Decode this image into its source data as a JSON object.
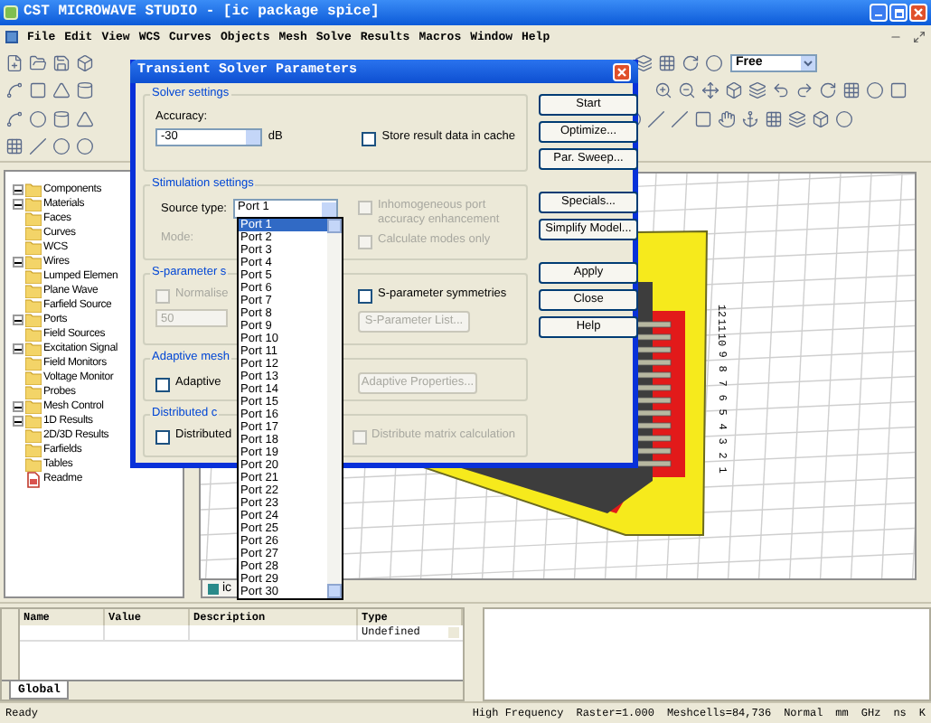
{
  "window": {
    "title": "CST MICROWAVE STUDIO - [ic package spice]"
  },
  "menu": [
    "File",
    "Edit",
    "View",
    "WCS",
    "Curves",
    "Objects",
    "Mesh",
    "Solve",
    "Results",
    "Macros",
    "Window",
    "Help"
  ],
  "toolbar": {
    "mode_select": "Free"
  },
  "tree": [
    {
      "label": "Components",
      "kind": "group"
    },
    {
      "label": "Materials",
      "kind": "group"
    },
    {
      "label": "Faces",
      "kind": "folder"
    },
    {
      "label": "Curves",
      "kind": "folder"
    },
    {
      "label": "WCS",
      "kind": "folder"
    },
    {
      "label": "Wires",
      "kind": "group"
    },
    {
      "label": "Lumped Elemen",
      "kind": "folder"
    },
    {
      "label": "Plane Wave",
      "kind": "folder"
    },
    {
      "label": "Farfield Source",
      "kind": "folder"
    },
    {
      "label": "Ports",
      "kind": "group"
    },
    {
      "label": "Field Sources",
      "kind": "folder"
    },
    {
      "label": "Excitation Signal",
      "kind": "group"
    },
    {
      "label": "Field Monitors",
      "kind": "folder"
    },
    {
      "label": "Voltage Monitor",
      "kind": "folder"
    },
    {
      "label": "Probes",
      "kind": "folder"
    },
    {
      "label": "Mesh Control",
      "kind": "group"
    },
    {
      "label": "1D Results",
      "kind": "group"
    },
    {
      "label": "2D/3D Results",
      "kind": "folder"
    },
    {
      "label": "Farfields",
      "kind": "folder"
    },
    {
      "label": "Tables",
      "kind": "folder"
    },
    {
      "label": "Readme",
      "kind": "document"
    }
  ],
  "canvas": {
    "port_numbers": [
      "12",
      "11",
      "10",
      "9",
      "8",
      "7",
      "6",
      "5",
      "4",
      "3",
      "2",
      "1"
    ],
    "doc_tab": "ic"
  },
  "dialog": {
    "title": "Transient Solver Parameters",
    "solver_settings": {
      "heading": "Solver settings",
      "accuracy_label": "Accuracy:",
      "accuracy": "-30",
      "unit": "dB",
      "store_cache": {
        "label": "Store result data in cache",
        "checked": false,
        "disabled": false
      }
    },
    "stimulation": {
      "heading": "Stimulation settings",
      "source_label": "Source type:",
      "source": "Port 1",
      "inhomogeneous": {
        "label": "Inhomogeneous port accuracy enhancement",
        "checked": false,
        "disabled": true
      },
      "mode_label": "Mode:",
      "calc_modes": {
        "label": "Calculate modes only",
        "checked": false,
        "disabled": true
      }
    },
    "sparams": {
      "heading": "S-parameter s",
      "normalize": {
        "label": "Normalise",
        "checked": false,
        "disabled": true
      },
      "impedance": "50",
      "symmetries": {
        "label": "S-parameter symmetries",
        "checked": false,
        "disabled": false
      },
      "list_button": {
        "label": "S-Parameter List...",
        "disabled": true
      }
    },
    "adaptive": {
      "heading": "Adaptive mesh",
      "checkbox": {
        "label": "Adaptive",
        "checked": false,
        "disabled": false
      },
      "button": {
        "label": "Adaptive Properties...",
        "disabled": true
      }
    },
    "distributed": {
      "heading": "Distributed c",
      "checkbox": {
        "label": "Distributed",
        "checked": false,
        "disabled": false
      },
      "matrix": {
        "label": "Distribute matrix calculation",
        "checked": false,
        "disabled": true
      }
    },
    "button_groups": [
      [
        "Start",
        "Optimize...",
        "Par. Sweep..."
      ],
      [
        "Specials...",
        "Simplify Model..."
      ],
      [
        "Apply",
        "Close",
        "Help"
      ]
    ],
    "source_list": [
      {
        "label": "Port 1",
        "selected": true
      },
      {
        "label": "Port 2",
        "selected": false
      },
      {
        "label": "Port 3",
        "selected": false
      },
      {
        "label": "Port 4",
        "selected": false
      },
      {
        "label": "Port 5",
        "selected": false
      },
      {
        "label": "Port 6",
        "selected": false
      },
      {
        "label": "Port 7",
        "selected": false
      },
      {
        "label": "Port 8",
        "selected": false
      },
      {
        "label": "Port 9",
        "selected": false
      },
      {
        "label": "Port 10",
        "selected": false
      },
      {
        "label": "Port 11",
        "selected": false
      },
      {
        "label": "Port 12",
        "selected": false
      },
      {
        "label": "Port 13",
        "selected": false
      },
      {
        "label": "Port 14",
        "selected": false
      },
      {
        "label": "Port 15",
        "selected": false
      },
      {
        "label": "Port 16",
        "selected": false
      },
      {
        "label": "Port 17",
        "selected": false
      },
      {
        "label": "Port 18",
        "selected": false
      },
      {
        "label": "Port 19",
        "selected": false
      },
      {
        "label": "Port 20",
        "selected": false
      },
      {
        "label": "Port 21",
        "selected": false
      },
      {
        "label": "Port 22",
        "selected": false
      },
      {
        "label": "Port 23",
        "selected": false
      },
      {
        "label": "Port 24",
        "selected": false
      },
      {
        "label": "Port 25",
        "selected": false
      },
      {
        "label": "Port 26",
        "selected": false
      },
      {
        "label": "Port 27",
        "selected": false
      },
      {
        "label": "Port 28",
        "selected": false
      },
      {
        "label": "Port 29",
        "selected": false
      },
      {
        "label": "Port 30",
        "selected": false
      }
    ]
  },
  "parameters": {
    "columns": [
      "Name",
      "Value",
      "Description",
      "Type"
    ],
    "rows": [
      {
        "type": "Undefined"
      }
    ],
    "tab": "Global"
  },
  "status_bar": {
    "message": "Ready",
    "fields": [
      "High Frequency",
      "Raster=1.000",
      "Meshcells=84,736",
      "Normal",
      "mm",
      "GHz",
      "ns",
      "K"
    ]
  }
}
